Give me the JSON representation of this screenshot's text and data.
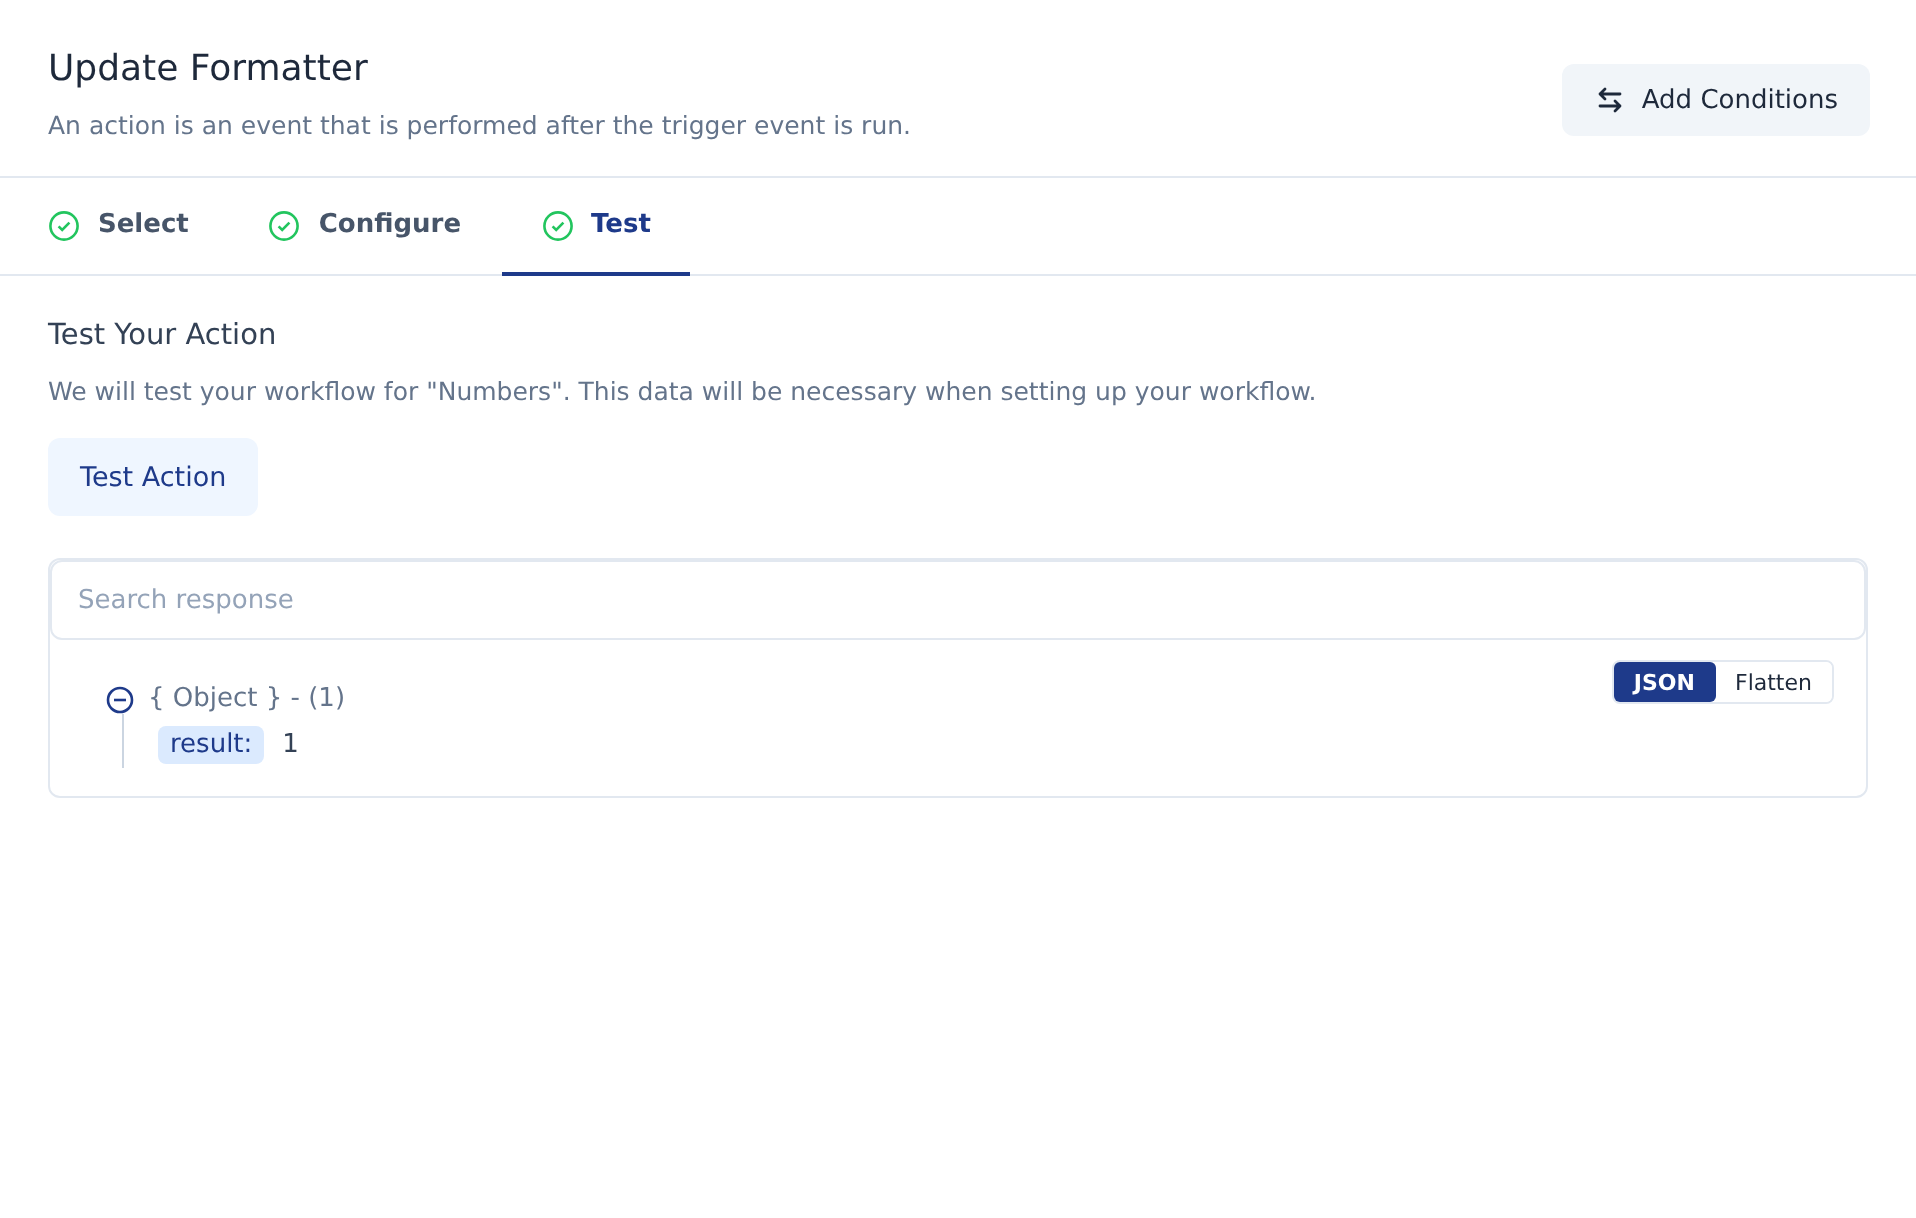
{
  "header": {
    "title": "Update Formatter",
    "subtitle": "An action is an event that is performed after the trigger event is run.",
    "button": "Add Conditions"
  },
  "steps": [
    {
      "label": "Select",
      "selected": false,
      "done": true
    },
    {
      "label": "Configure",
      "selected": false,
      "done": true
    },
    {
      "label": "Test",
      "selected": true,
      "done": true
    }
  ],
  "test": {
    "title": "Test Your Action",
    "description": "We will test your workflow for \"Numbers\". This data will be necessary when setting up your workflow.",
    "button": "Test Action"
  },
  "response": {
    "search": {
      "placeholder": "Search response"
    },
    "views": [
      {
        "label": "JSON",
        "selected": true
      },
      {
        "label": "Flatten",
        "selected": false
      }
    ],
    "tree": {
      "label": "{ Object } - (1)",
      "expanded": true,
      "children": [
        {
          "key": "result:",
          "value": "1"
        }
      ]
    }
  }
}
